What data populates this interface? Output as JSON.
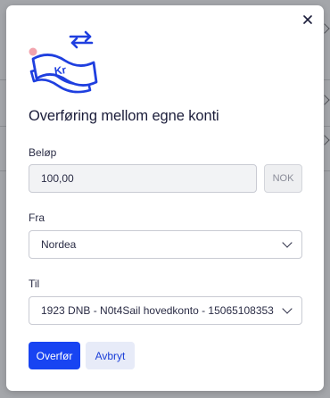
{
  "modal": {
    "close_icon": "close-icon",
    "illustration_icon": "money-transfer-icon",
    "illustration_text": "Kr",
    "title": "Overføring mellom egne konti",
    "amount": {
      "label": "Beløp",
      "value": "100,00",
      "currency": "NOK"
    },
    "from": {
      "label": "Fra",
      "selected": "Nordea"
    },
    "to": {
      "label": "Til",
      "selected": "1923 DNB - N0t4Sail hovedkonto - 15065108353"
    },
    "buttons": {
      "submit": "Overfør",
      "cancel": "Avbryt"
    }
  },
  "colors": {
    "primary": "#1844f2",
    "secondary_bg": "#e7ebf8",
    "illustration_blue": "#1f3fdf",
    "illustration_pink": "#f2a3ad",
    "overlay": "#a4a6aa"
  }
}
